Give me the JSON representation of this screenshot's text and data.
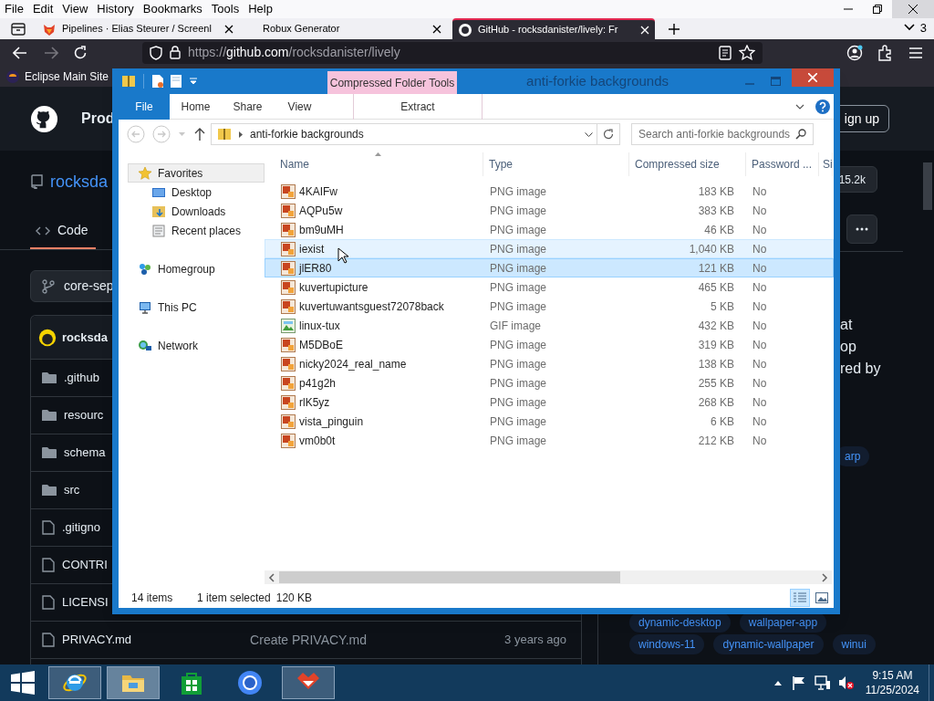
{
  "browser": {
    "menu": [
      "File",
      "Edit",
      "View",
      "History",
      "Bookmarks",
      "Tools",
      "Help"
    ],
    "tabs": [
      {
        "title": "Pipelines · Elias Steurer / Screenl",
        "kind": "fox",
        "selected": false
      },
      {
        "title": "Robux Generator",
        "kind": "blank",
        "selected": false
      },
      {
        "title": "GitHub - rocksdanister/lively: Fr",
        "kind": "octocat",
        "selected": true
      }
    ],
    "tab_count": "3",
    "url": {
      "scheme": "https://",
      "host": "github.com",
      "path": "/rocksdanister/lively"
    },
    "bookmarks": [
      "Eclipse Main Site"
    ]
  },
  "github": {
    "header_text": "Prod",
    "signup": "ign up",
    "repo": "rocksda",
    "stars": "15.2k",
    "code_tab": "Code",
    "branch": "core-sep",
    "commit_author": "rocksda",
    "files": [
      {
        "name": ".github",
        "kind": "folder"
      },
      {
        "name": "resourc",
        "kind": "folder"
      },
      {
        "name": "schema",
        "kind": "folder"
      },
      {
        "name": "src",
        "kind": "folder"
      },
      {
        "name": ".gitigno",
        "kind": "file"
      },
      {
        "name": "CONTRI",
        "kind": "file"
      },
      {
        "name": "LICENSI",
        "kind": "file"
      },
      {
        "name": "PRIVACY.md",
        "kind": "file",
        "message": "Create PRIVACY.md",
        "age": "3 years ago"
      }
    ],
    "about_lines": [
      "at",
      "op",
      "red by"
    ],
    "topic_rows": [
      [
        "arp"
      ],
      [
        "dynamic-desktop",
        "wallpaper-app"
      ],
      [
        "windows-11",
        "dynamic-wallpaper",
        "winui"
      ]
    ]
  },
  "explorer": {
    "title": "anti-forkie backgrounds",
    "context_tab": "Compressed Folder Tools",
    "ribbon_tabs": [
      {
        "label": "File",
        "kind": "file"
      },
      {
        "label": "Home",
        "kind": "tab"
      },
      {
        "label": "Share",
        "kind": "tab"
      },
      {
        "label": "View",
        "kind": "tab"
      },
      {
        "label": "Extract",
        "kind": "context"
      }
    ],
    "address": "anti-forkie backgrounds",
    "search_placeholder": "Search anti-forkie backgrounds",
    "nav": [
      {
        "label": "Favorites",
        "kind": "star",
        "selected": true,
        "children": [
          {
            "label": "Desktop",
            "kind": "desktop",
            "selected": false
          },
          {
            "label": "Downloads",
            "kind": "downloads",
            "selected": false
          },
          {
            "label": "Recent places",
            "kind": "recent",
            "selected": false
          }
        ]
      },
      {
        "label": "Homegroup",
        "kind": "homegroup",
        "selected": false
      },
      {
        "label": "This PC",
        "kind": "pc",
        "selected": false
      },
      {
        "label": "Network",
        "kind": "network",
        "selected": false
      }
    ],
    "columns": [
      "Name",
      "Type",
      "Compressed size",
      "Password ...",
      "Si"
    ],
    "rows": [
      {
        "name": "4KAIFw",
        "type": "PNG image",
        "size": "183 KB",
        "password": "No",
        "kind": "png",
        "selected": false,
        "hovered": false
      },
      {
        "name": "AQPu5w",
        "type": "PNG image",
        "size": "383 KB",
        "password": "No",
        "kind": "png",
        "selected": false,
        "hovered": false
      },
      {
        "name": "bm9uMH",
        "type": "PNG image",
        "size": "46 KB",
        "password": "No",
        "kind": "png",
        "selected": false,
        "hovered": false
      },
      {
        "name": "iexist",
        "type": "PNG image",
        "size": "1,040 KB",
        "password": "No",
        "kind": "png",
        "selected": false,
        "hovered": true
      },
      {
        "name": "jlER80",
        "type": "PNG image",
        "size": "121 KB",
        "password": "No",
        "kind": "png",
        "selected": true,
        "hovered": false
      },
      {
        "name": "kuvertupicture",
        "type": "PNG image",
        "size": "465 KB",
        "password": "No",
        "kind": "png",
        "selected": false,
        "hovered": false
      },
      {
        "name": "kuvertuwantsguest72078back",
        "type": "PNG image",
        "size": "5 KB",
        "password": "No",
        "kind": "png",
        "selected": false,
        "hovered": false
      },
      {
        "name": "linux-tux",
        "type": "GIF image",
        "size": "432 KB",
        "password": "No",
        "kind": "gif",
        "selected": false,
        "hovered": false
      },
      {
        "name": "M5DBoE",
        "type": "PNG image",
        "size": "319 KB",
        "password": "No",
        "kind": "png",
        "selected": false,
        "hovered": false
      },
      {
        "name": "nicky2024_real_name",
        "type": "PNG image",
        "size": "138 KB",
        "password": "No",
        "kind": "png",
        "selected": false,
        "hovered": false
      },
      {
        "name": "p41g2h",
        "type": "PNG image",
        "size": "255 KB",
        "password": "No",
        "kind": "png",
        "selected": false,
        "hovered": false
      },
      {
        "name": "rlK5yz",
        "type": "PNG image",
        "size": "268 KB",
        "password": "No",
        "kind": "png",
        "selected": false,
        "hovered": false
      },
      {
        "name": "vista_pinguin",
        "type": "PNG image",
        "size": "6 KB",
        "password": "No",
        "kind": "png",
        "selected": false,
        "hovered": false
      },
      {
        "name": "vm0b0t",
        "type": "PNG image",
        "size": "212 KB",
        "password": "No",
        "kind": "png",
        "selected": false,
        "hovered": false
      }
    ],
    "status": {
      "count": "14 items",
      "selection": "1 item selected",
      "size": "120 KB"
    }
  },
  "taskbar": {
    "apps": [
      {
        "kind": "ie",
        "running": true,
        "active": false
      },
      {
        "kind": "explorer",
        "running": true,
        "active": true
      },
      {
        "kind": "store",
        "running": false,
        "active": false
      },
      {
        "kind": "browser",
        "running": false,
        "active": false
      },
      {
        "kind": "fox",
        "running": true,
        "active": false
      }
    ],
    "time": "9:15 AM",
    "date": "11/25/2024"
  }
}
